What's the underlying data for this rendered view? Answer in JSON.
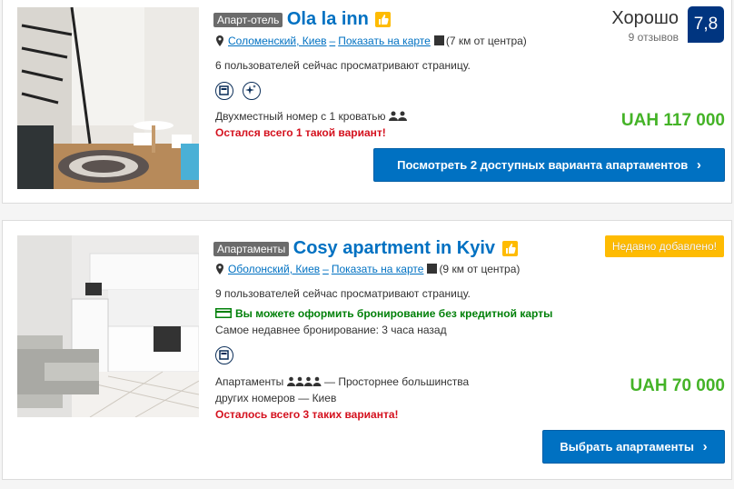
{
  "listings": [
    {
      "type": "Апарт-отель",
      "name": "Ola la inn",
      "location": "Соломенский, Киев",
      "show_on_map": "Показать на карте",
      "distance": "(7 км от центра)",
      "viewers": "6 пользователей сейчас просматривают страницу.",
      "room": "Двухместный номер с 1 кроватью",
      "scarcity": "Остался всего 1 такой вариант!",
      "price": "UAH 117 000",
      "button": "Посмотреть 2 доступных варианта апартаментов",
      "score_word": "Хорошо",
      "reviews": "9 отзывов",
      "score": "7,8"
    },
    {
      "type": "Апартаменты",
      "name": "Cosy apartment in Kyiv",
      "location": "Оболонский, Киев",
      "show_on_map": "Показать на карте",
      "distance": "(9 км от центра)",
      "viewers": "9 пользователей сейчас просматривают страницу.",
      "no_card": "Вы можете оформить бронирование без кредитной карты",
      "recent_booking": "Самое недавнее бронирование: 3 часа назад",
      "room_line1": "Апартаменты",
      "room_line1b": "— Просторнее большинства",
      "room_line2": "других номеров — Киев",
      "scarcity": "Осталось всего 3 таких варианта!",
      "price": "UAH 70 000",
      "button": "Выбрать апартаменты",
      "new_badge": "Недавно добавлено!"
    }
  ],
  "separator": "–",
  "chevron": "›",
  "colors": {
    "link": "#0071c2",
    "price": "#44b327",
    "alert": "#d4111e",
    "score_bg": "#003580",
    "badge": "#febb02"
  },
  "icons": [
    "pin-icon",
    "thumbs-up-icon",
    "distance-icon",
    "coffee-machine-icon",
    "sparkle-icon",
    "person-icon",
    "credit-card-icon",
    "chevron-right-icon"
  ]
}
